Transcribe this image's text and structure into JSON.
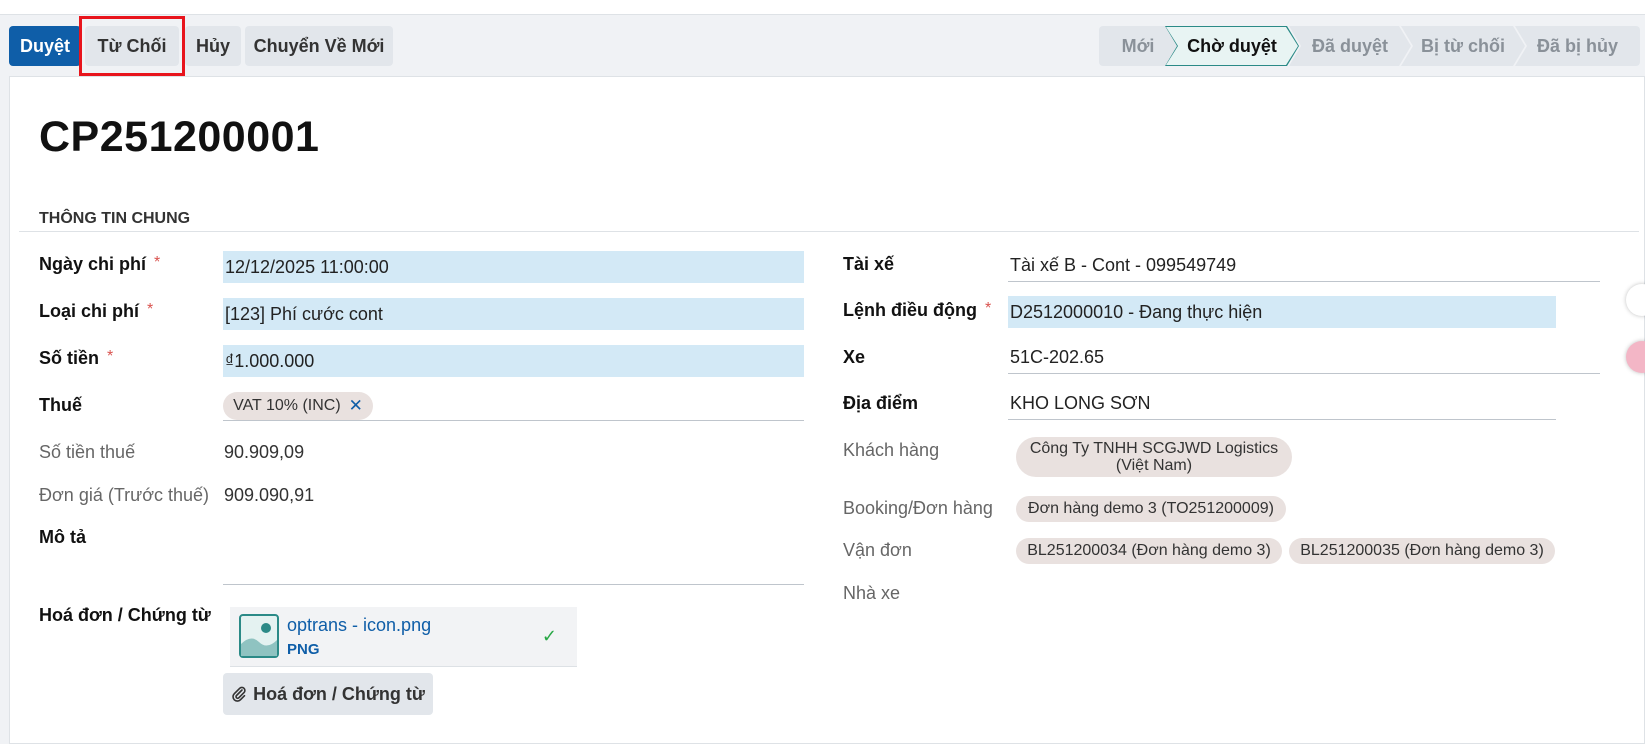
{
  "toolbar": {
    "approve_label": "Duyệt",
    "reject_label": "Từ Chối",
    "cancel_label": "Hủy",
    "reset_label": "Chuyển Về Mới"
  },
  "statusbar": {
    "stages": [
      "Mới",
      "Chờ duyệt",
      "Đã duyệt",
      "Bị từ chối",
      "Đã bị hủy"
    ],
    "active": "Chờ duyệt"
  },
  "record": {
    "title": "CP251200001",
    "section_title": "THÔNG TIN CHUNG"
  },
  "left": {
    "date_label": "Ngày chi phí",
    "date_value": "12/12/2025 11:00:00",
    "type_label": "Loại chi phí",
    "type_value": "[123] Phí cước cont",
    "amount_label": "Số tiền",
    "amount_value": "₫1.000.000",
    "tax_label": "Thuế",
    "tax_tag": "VAT 10% (INC)",
    "tax_amount_label": "Số tiền thuế",
    "tax_amount_value": "90.909,09",
    "unit_price_label": "Đơn giá (Trước thuế)",
    "unit_price_value": "909.090,91",
    "description_label": "Mô tả",
    "attachment_label": "Hoá đơn / Chứng từ",
    "attachment_name": "optrans - icon.png",
    "attachment_type": "PNG",
    "attachment_button": "Hoá đơn / Chứng từ"
  },
  "right": {
    "driver_label": "Tài xế",
    "driver_value": "Tài xế B - Cont - 099549749",
    "dispatch_label": "Lệnh điều động",
    "dispatch_value": "D2512000010 - Đang thực hiện",
    "vehicle_label": "Xe",
    "vehicle_value": "51C-202.65",
    "location_label": "Địa điểm",
    "location_value": "KHO LONG SƠN",
    "customer_label": "Khách hàng",
    "customer_line1": "Công Ty TNHH SCGJWD Logistics",
    "customer_line2": "(Việt Nam)",
    "booking_label": "Booking/Đơn hàng",
    "booking_tag": "Đơn hàng demo 3 (TO251200009)",
    "waybill_label": "Vận đơn",
    "waybill_tags": [
      "BL251200034 (Đơn hàng demo 3)",
      "BL251200035 (Đơn hàng demo 3)"
    ],
    "carrier_label": "Nhà xe"
  },
  "colors": {
    "primary": "#0f5ea8",
    "required_bg": "#d3e9f6",
    "highlight": "#e8141c",
    "active_stage_border": "#2b8a87"
  }
}
